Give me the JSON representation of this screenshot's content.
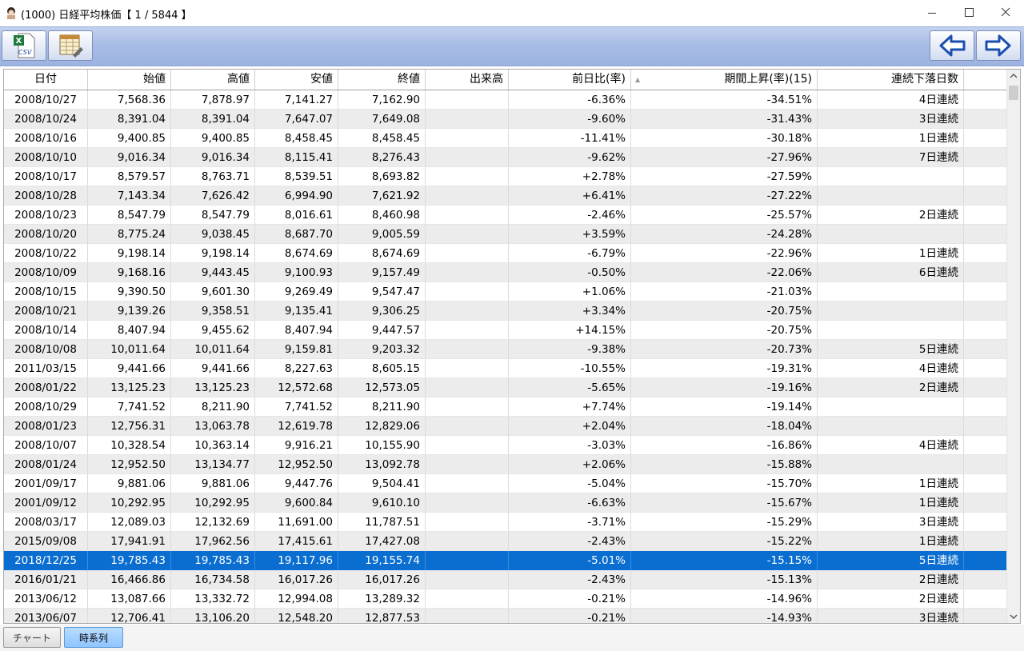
{
  "window": {
    "title": "(1000) 日経平均株価【 1 / 5844 】"
  },
  "toolbar": {
    "csv_icon_text": "CSV",
    "nav_back_icon": "arrow-left-icon",
    "nav_forward_icon": "arrow-right-icon"
  },
  "table": {
    "columns": [
      "日付",
      "始値",
      "高値",
      "安値",
      "終値",
      "出来高",
      "前日比(率)",
      "期間上昇(率)(15)",
      "連続下落日数"
    ],
    "sorted_column": "前日比(率)",
    "rows": [
      [
        "2008/10/27",
        "7,568.36",
        "7,878.97",
        "7,141.27",
        "7,162.90",
        "",
        "-6.36%",
        "-34.51%",
        "4日連続"
      ],
      [
        "2008/10/24",
        "8,391.04",
        "8,391.04",
        "7,647.07",
        "7,649.08",
        "",
        "-9.60%",
        "-31.43%",
        "3日連続"
      ],
      [
        "2008/10/16",
        "9,400.85",
        "9,400.85",
        "8,458.45",
        "8,458.45",
        "",
        "-11.41%",
        "-30.18%",
        "1日連続"
      ],
      [
        "2008/10/10",
        "9,016.34",
        "9,016.34",
        "8,115.41",
        "8,276.43",
        "",
        "-9.62%",
        "-27.96%",
        "7日連続"
      ],
      [
        "2008/10/17",
        "8,579.57",
        "8,763.71",
        "8,539.51",
        "8,693.82",
        "",
        "+2.78%",
        "-27.59%",
        ""
      ],
      [
        "2008/10/28",
        "7,143.34",
        "7,626.42",
        "6,994.90",
        "7,621.92",
        "",
        "+6.41%",
        "-27.22%",
        ""
      ],
      [
        "2008/10/23",
        "8,547.79",
        "8,547.79",
        "8,016.61",
        "8,460.98",
        "",
        "-2.46%",
        "-25.57%",
        "2日連続"
      ],
      [
        "2008/10/20",
        "8,775.24",
        "9,038.45",
        "8,687.70",
        "9,005.59",
        "",
        "+3.59%",
        "-24.28%",
        ""
      ],
      [
        "2008/10/22",
        "9,198.14",
        "9,198.14",
        "8,674.69",
        "8,674.69",
        "",
        "-6.79%",
        "-22.96%",
        "1日連続"
      ],
      [
        "2008/10/09",
        "9,168.16",
        "9,443.45",
        "9,100.93",
        "9,157.49",
        "",
        "-0.50%",
        "-22.06%",
        "6日連続"
      ],
      [
        "2008/10/15",
        "9,390.50",
        "9,601.30",
        "9,269.49",
        "9,547.47",
        "",
        "+1.06%",
        "-21.03%",
        ""
      ],
      [
        "2008/10/21",
        "9,139.26",
        "9,358.51",
        "9,135.41",
        "9,306.25",
        "",
        "+3.34%",
        "-20.75%",
        ""
      ],
      [
        "2008/10/14",
        "8,407.94",
        "9,455.62",
        "8,407.94",
        "9,447.57",
        "",
        "+14.15%",
        "-20.75%",
        ""
      ],
      [
        "2008/10/08",
        "10,011.64",
        "10,011.64",
        "9,159.81",
        "9,203.32",
        "",
        "-9.38%",
        "-20.73%",
        "5日連続"
      ],
      [
        "2011/03/15",
        "9,441.66",
        "9,441.66",
        "8,227.63",
        "8,605.15",
        "",
        "-10.55%",
        "-19.31%",
        "4日連続"
      ],
      [
        "2008/01/22",
        "13,125.23",
        "13,125.23",
        "12,572.68",
        "12,573.05",
        "",
        "-5.65%",
        "-19.16%",
        "2日連続"
      ],
      [
        "2008/10/29",
        "7,741.52",
        "8,211.90",
        "7,741.52",
        "8,211.90",
        "",
        "+7.74%",
        "-19.14%",
        ""
      ],
      [
        "2008/01/23",
        "12,756.31",
        "13,063.78",
        "12,619.78",
        "12,829.06",
        "",
        "+2.04%",
        "-18.04%",
        ""
      ],
      [
        "2008/10/07",
        "10,328.54",
        "10,363.14",
        "9,916.21",
        "10,155.90",
        "",
        "-3.03%",
        "-16.86%",
        "4日連続"
      ],
      [
        "2008/01/24",
        "12,952.50",
        "13,134.77",
        "12,952.50",
        "13,092.78",
        "",
        "+2.06%",
        "-15.88%",
        ""
      ],
      [
        "2001/09/17",
        "9,881.06",
        "9,881.06",
        "9,447.76",
        "9,504.41",
        "",
        "-5.04%",
        "-15.70%",
        "1日連続"
      ],
      [
        "2001/09/12",
        "10,292.95",
        "10,292.95",
        "9,600.84",
        "9,610.10",
        "",
        "-6.63%",
        "-15.67%",
        "1日連続"
      ],
      [
        "2008/03/17",
        "12,089.03",
        "12,132.69",
        "11,691.00",
        "11,787.51",
        "",
        "-3.71%",
        "-15.29%",
        "3日連続"
      ],
      [
        "2015/09/08",
        "17,941.91",
        "17,962.56",
        "17,415.61",
        "17,427.08",
        "",
        "-2.43%",
        "-15.22%",
        "1日連続"
      ],
      [
        "2018/12/25",
        "19,785.43",
        "19,785.43",
        "19,117.96",
        "19,155.74",
        "",
        "-5.01%",
        "-15.15%",
        "5日連続"
      ],
      [
        "2016/01/21",
        "16,466.86",
        "16,734.58",
        "16,017.26",
        "16,017.26",
        "",
        "-2.43%",
        "-15.13%",
        "2日連続"
      ],
      [
        "2013/06/12",
        "13,087.66",
        "13,332.72",
        "12,994.08",
        "13,289.32",
        "",
        "-0.21%",
        "-14.96%",
        "2日連続"
      ],
      [
        "2013/06/07",
        "12,706.41",
        "13,106.20",
        "12,548.20",
        "12,877.53",
        "",
        "-0.21%",
        "-14.93%",
        "3日連続"
      ]
    ],
    "selected_row_index": 24
  },
  "tabs": [
    {
      "label": "チャート",
      "active": false
    },
    {
      "label": "時系列",
      "active": true
    }
  ],
  "colors": {
    "selection": "#0a6ed1",
    "toolbar": "#a8bde6",
    "active_tab": "#a6d0ff"
  }
}
